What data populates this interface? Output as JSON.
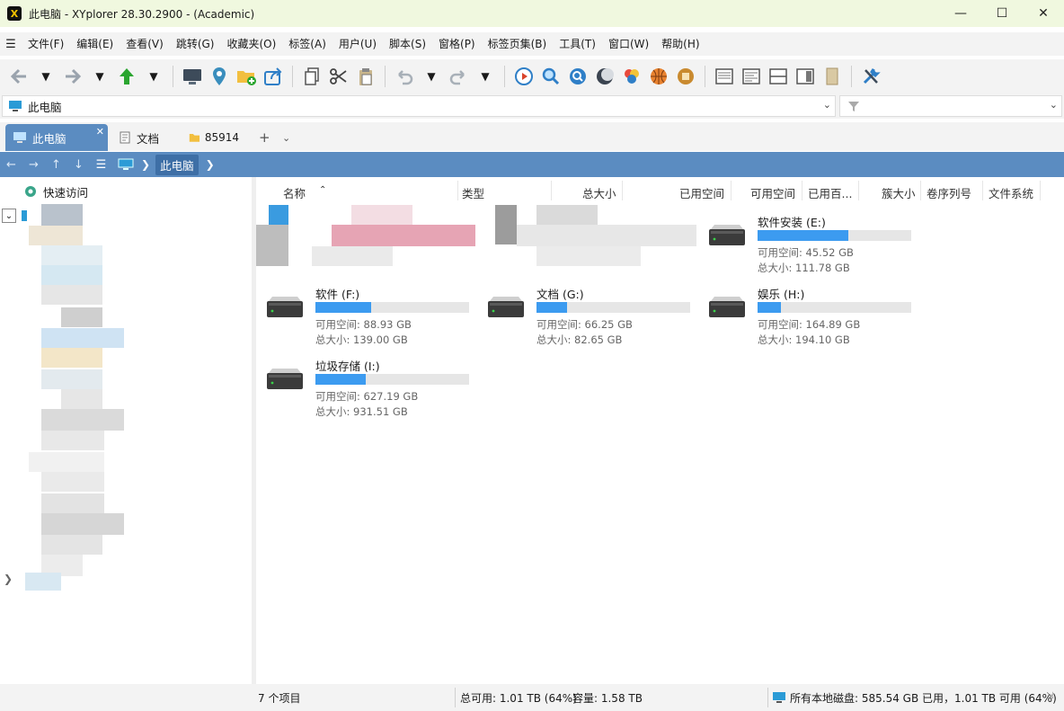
{
  "window": {
    "title": "此电脑 - XYplorer 28.30.2900 - (Academic)",
    "app_icon": "X"
  },
  "menu": [
    "文件(F)",
    "编辑(E)",
    "查看(V)",
    "跳转(G)",
    "收藏夹(O)",
    "标签(A)",
    "用户(U)",
    "脚本(S)",
    "窗格(P)",
    "标签页集(B)",
    "工具(T)",
    "窗口(W)",
    "帮助(H)"
  ],
  "address": {
    "value": "此电脑"
  },
  "tabs": [
    {
      "label": "此电脑",
      "icon": "monitor-icon"
    },
    {
      "label": "文档",
      "icon": "document-icon"
    },
    {
      "label": "85914",
      "icon": "folder-icon"
    }
  ],
  "breadcrumb": {
    "current": "此电脑"
  },
  "tree": {
    "quick_access": "快速访问"
  },
  "columns": [
    "名称",
    "类型",
    "总大小",
    "已用空间",
    "可用空间",
    "已用百...",
    "簇大小",
    "卷序列号",
    "文件系统"
  ],
  "drives": [
    {
      "name": "软件安装 (E:)",
      "free": "可用空间: 45.52 GB",
      "total": "总大小: 111.78 GB",
      "used_fraction": 0.59
    },
    {
      "name": "软件 (F:)",
      "free": "可用空间: 88.93 GB",
      "total": "总大小: 139.00 GB",
      "used_fraction": 0.36
    },
    {
      "name": "文档 (G:)",
      "free": "可用空间: 66.25 GB",
      "total": "总大小: 82.65 GB",
      "used_fraction": 0.2
    },
    {
      "name": "娱乐 (H:)",
      "free": "可用空间: 164.89 GB",
      "total": "总大小: 194.10 GB",
      "used_fraction": 0.15
    },
    {
      "name": "垃圾存储 (I:)",
      "free": "可用空间: 627.19 GB",
      "total": "总大小: 931.51 GB",
      "used_fraction": 0.33
    }
  ],
  "status": {
    "items": "7 个项目",
    "total_free": "总可用: 1.01 TB (64%)",
    "capacity": "容量: 1.58 TB",
    "all_local": "所有本地磁盘: 585.54 GB 已用，1.01 TB 可用 (64%)"
  },
  "colors": {
    "accent": "#5b8cc1",
    "bar_fill": "#3c9bf0",
    "title_bg": "#f0f8df"
  }
}
